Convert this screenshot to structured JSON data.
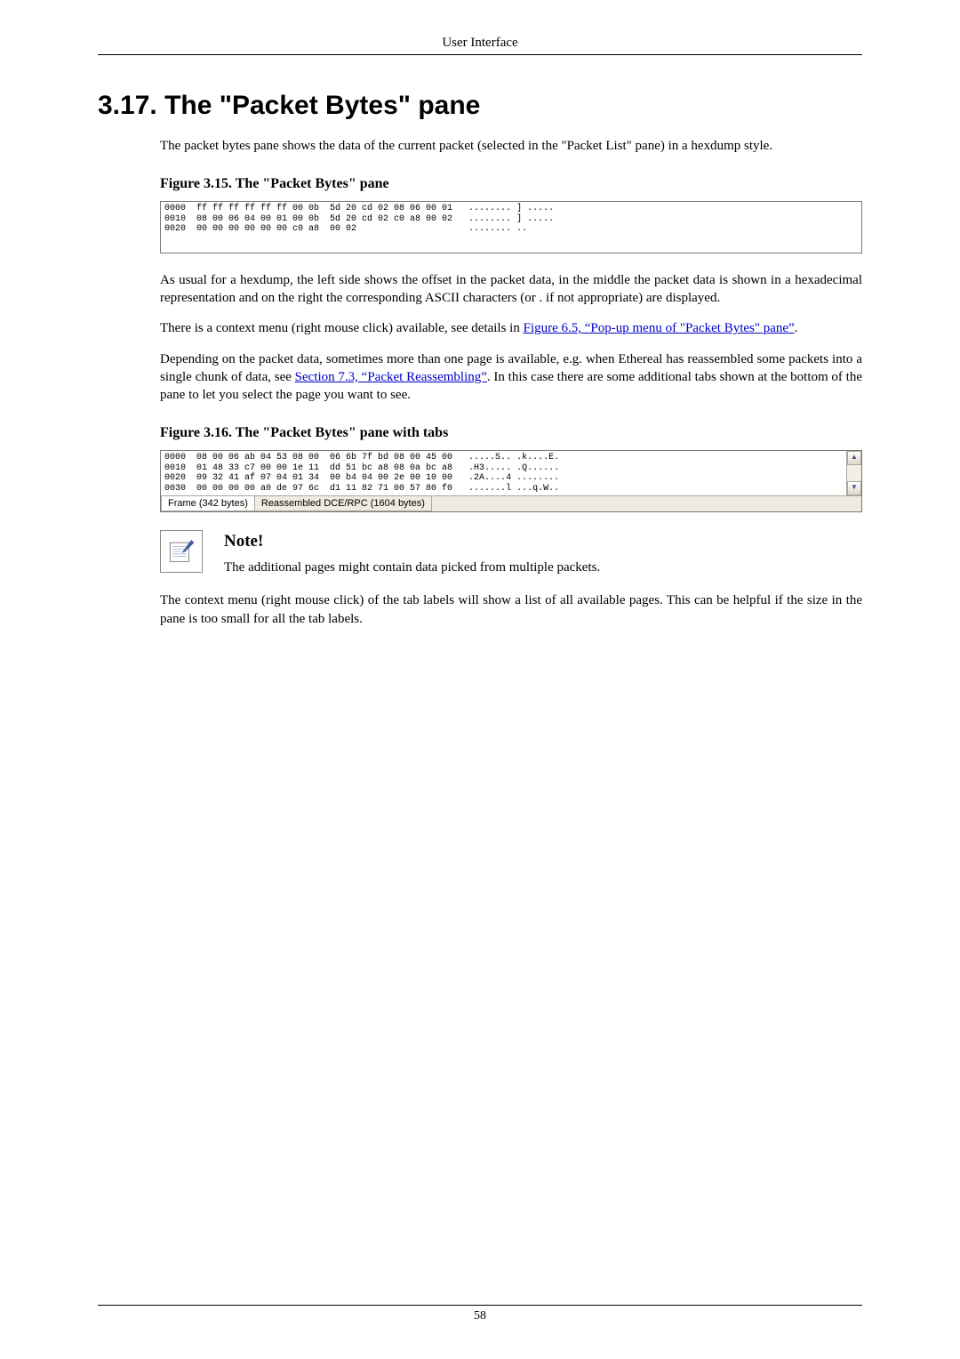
{
  "header": {
    "title": "User Interface"
  },
  "section": {
    "number": "3.17.",
    "title": "The \"Packet Bytes\" pane"
  },
  "para1": "The packet bytes pane shows the data of the current packet (selected in the \"Packet List\" pane) in a hexdump style.",
  "fig315": {
    "caption": "Figure 3.15. The \"Packet Bytes\" pane",
    "lines": [
      "0000  ff ff ff ff ff ff 00 0b  5d 20 cd 02 08 06 00 01   ........ ] .....",
      "0010  08 00 06 04 00 01 00 0b  5d 20 cd 02 c0 a8 00 02   ........ ] .....",
      "0020  00 00 00 00 00 00 c0 a8  00 02                     ........ .."
    ]
  },
  "para2": "As usual for a hexdump, the left side shows the offset in the packet data, in the middle the packet data is shown in a hexadecimal representation and on the right the corresponding ASCII characters (or . if not appropriate) are displayed.",
  "para3_pre": "There is a context menu (right mouse click) available, see details in ",
  "para3_link": "Figure 6.5, “Pop-up menu of \"Packet Bytes\" pane”",
  "para3_post": ".",
  "para4_pre": "Depending on the packet data, sometimes more than one page is available, e.g. when Ethereal has reassembled some packets into a single chunk of data, see ",
  "para4_link": "Section 7.3, “Packet Reassembling”",
  "para4_post": ". In this case there are some additional tabs shown at the bottom of the pane to let you select the page you want to see.",
  "fig316": {
    "caption": "Figure 3.16. The \"Packet Bytes\" pane with tabs",
    "lines": [
      "0000  08 00 06 ab 04 53 08 00  06 6b 7f bd 08 00 45 00   .....S.. .k....E.",
      "0010  01 48 33 c7 00 00 1e 11  dd 51 bc a8 08 0a bc a8   .H3..... .Q......",
      "0020  09 32 41 af 07 04 01 34  00 b4 04 00 2e 00 10 00   .2A....4 ........",
      "0030  00 00 00 00 a0 de 97 6c  d1 11 82 71 00 57 80 f0   .......l ...q.W.."
    ],
    "tabs": {
      "active": "Frame (342 bytes)",
      "other": "Reassembled DCE/RPC (1604 bytes)"
    },
    "scroll_up": "▲",
    "scroll_down": "▼"
  },
  "note": {
    "heading": "Note!",
    "text": "The additional pages might contain data picked from multiple packets."
  },
  "para5": "The context menu (right mouse click) of the tab labels will show a list of all available pages. This can be helpful if the size in the pane is too small for all the tab labels.",
  "footer": {
    "page": "58"
  }
}
